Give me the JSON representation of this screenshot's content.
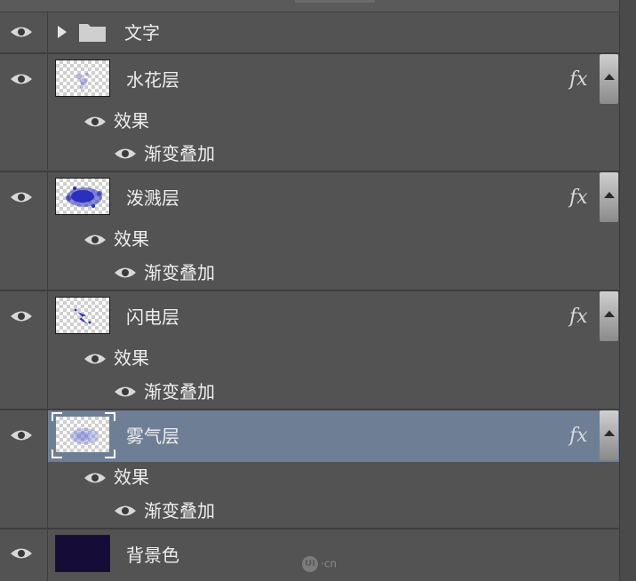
{
  "layers_panel": {
    "group": {
      "name": "文字"
    },
    "layers": [
      {
        "name": "水花层",
        "effects_label": "效果",
        "effect": "渐变叠加",
        "fx": "fx",
        "selected": false
      },
      {
        "name": "泼溅层",
        "effects_label": "效果",
        "effect": "渐变叠加",
        "fx": "fx",
        "selected": false
      },
      {
        "name": "闪电层",
        "effects_label": "效果",
        "effect": "渐变叠加",
        "fx": "fx",
        "selected": false
      },
      {
        "name": "雾气层",
        "effects_label": "效果",
        "effect": "渐变叠加",
        "fx": "fx",
        "selected": true
      }
    ],
    "background": {
      "name": "背景色",
      "color": "#150c38"
    }
  },
  "watermark": {
    "text": "·cn",
    "logo": "UI"
  },
  "colors": {
    "panel": "#535353",
    "selected_row": "#6e7f95",
    "layer_blue": "#2a2fbf"
  }
}
